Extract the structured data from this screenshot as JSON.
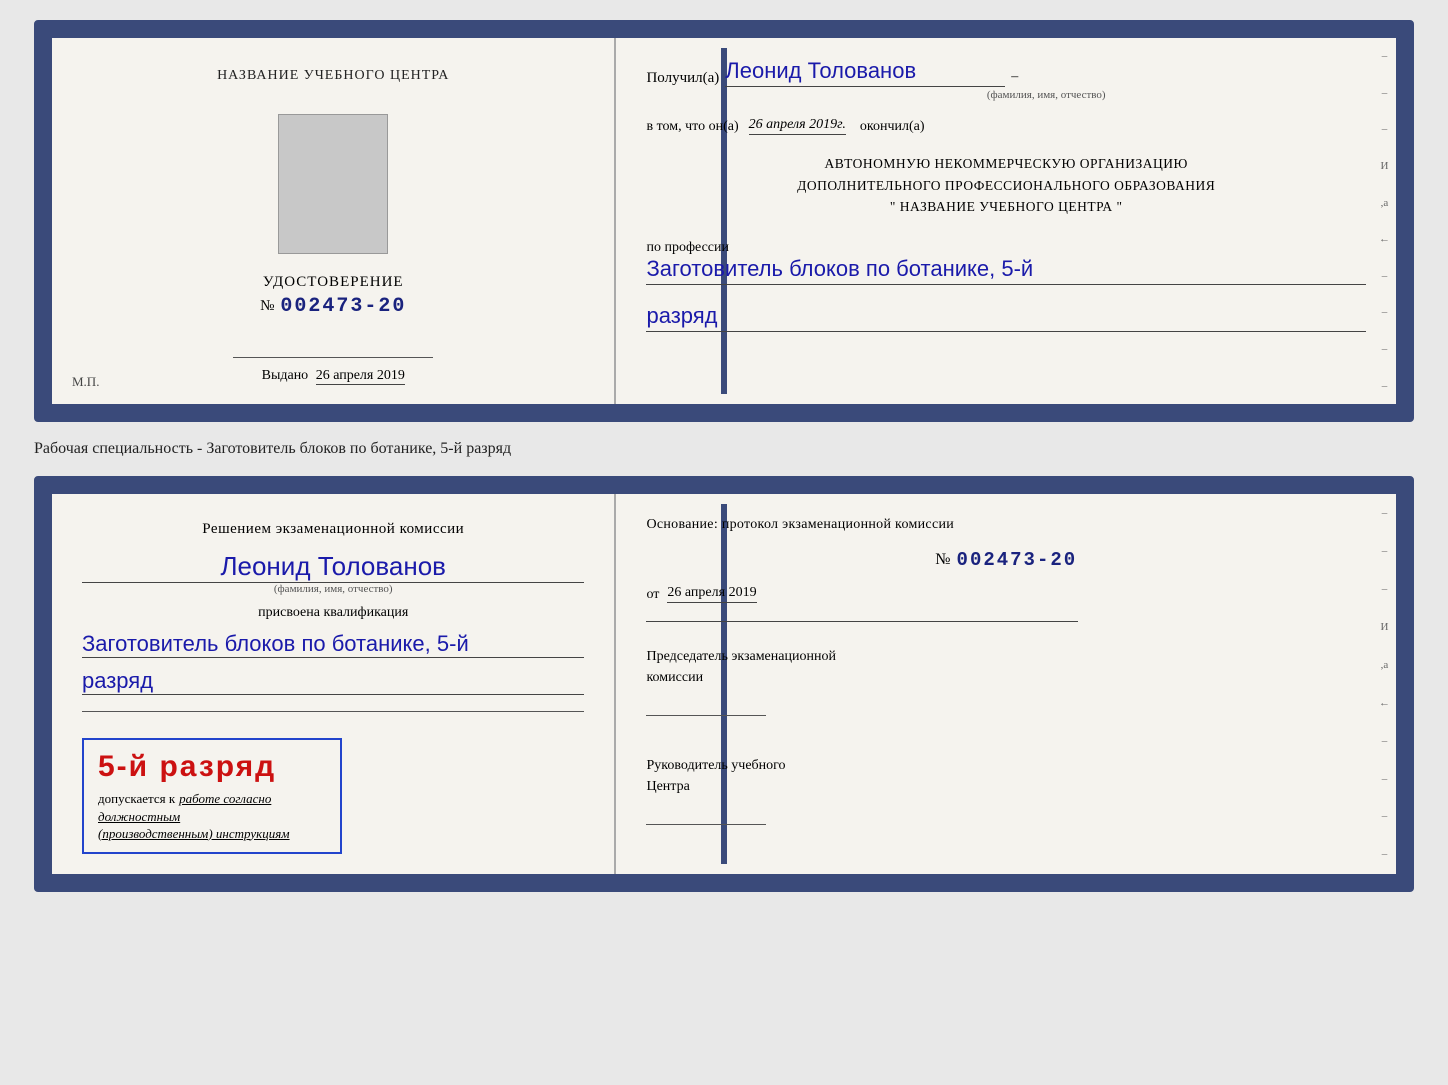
{
  "doc1": {
    "left": {
      "header": "НАЗВАНИЕ УЧЕБНОГО ЦЕНТРА",
      "udostoverenie_label": "УДОСТОВЕРЕНИЕ",
      "number_prefix": "№",
      "number": "002473-20",
      "vydano_label": "Выдано",
      "vydano_date": "26 апреля 2019",
      "mp_label": "М.П."
    },
    "right": {
      "poluchil_label": "Получил(a)",
      "poluchil_name": "Леонид Толованов",
      "fio_label": "(фамилия, имя, отчество)",
      "vtom_label": "в том, что он(а)",
      "vtom_date": "26 апреля 2019г.",
      "okonchil_label": "окончил(a)",
      "org_line1": "АВТОНОМНУЮ НЕКОММЕРЧЕСКУЮ ОРГАНИЗАЦИЮ",
      "org_line2": "ДОПОЛНИТЕЛЬНОГО ПРОФЕССИОНАЛЬНОГО ОБРАЗОВАНИЯ",
      "org_name": "\"  НАЗВАНИЕ УЧЕБНОГО ЦЕНТРА  \"",
      "po_professii_label": "по профессии",
      "profession": "Заготовитель блоков по ботанике, 5-й",
      "razryad": "разряд",
      "side_markers": [
        "–",
        "–",
        "–",
        "И",
        ",а",
        "←",
        "–",
        "–",
        "–",
        "–"
      ]
    }
  },
  "specialty_label": "Рабочая специальность - Заготовитель блоков по ботанике, 5-й разряд",
  "doc2": {
    "left": {
      "resheniem_label": "Решением экзаменационной комиссии",
      "person_name": "Леонид Толованов",
      "fio_label": "(фамилия, имя, отчество)",
      "prisvoena_label": "присвоена квалификация",
      "profession": "Заготовитель блоков по ботанике, 5-й",
      "razryad": "разряд",
      "stamp_grade": "5-й разряд",
      "dopuskaetsya_label": "допускается к",
      "dopuskaetsya_text": "работе согласно должностным",
      "instruktsii_text": "(производственным) инструкциям"
    },
    "right": {
      "osnovanie_label": "Основание: протокол экзаменационной комиссии",
      "number_prefix": "№",
      "number": "002473-20",
      "ot_label": "от",
      "ot_date": "26 апреля 2019",
      "predsedatel_line1": "Председатель экзаменационной",
      "predsedatel_line2": "комиссии",
      "rukovoditel_line1": "Руководитель учебного",
      "rukovoditel_line2": "Центра",
      "side_markers": [
        "–",
        "–",
        "–",
        "И",
        ",а",
        "←",
        "–",
        "–",
        "–",
        "–"
      ]
    }
  }
}
